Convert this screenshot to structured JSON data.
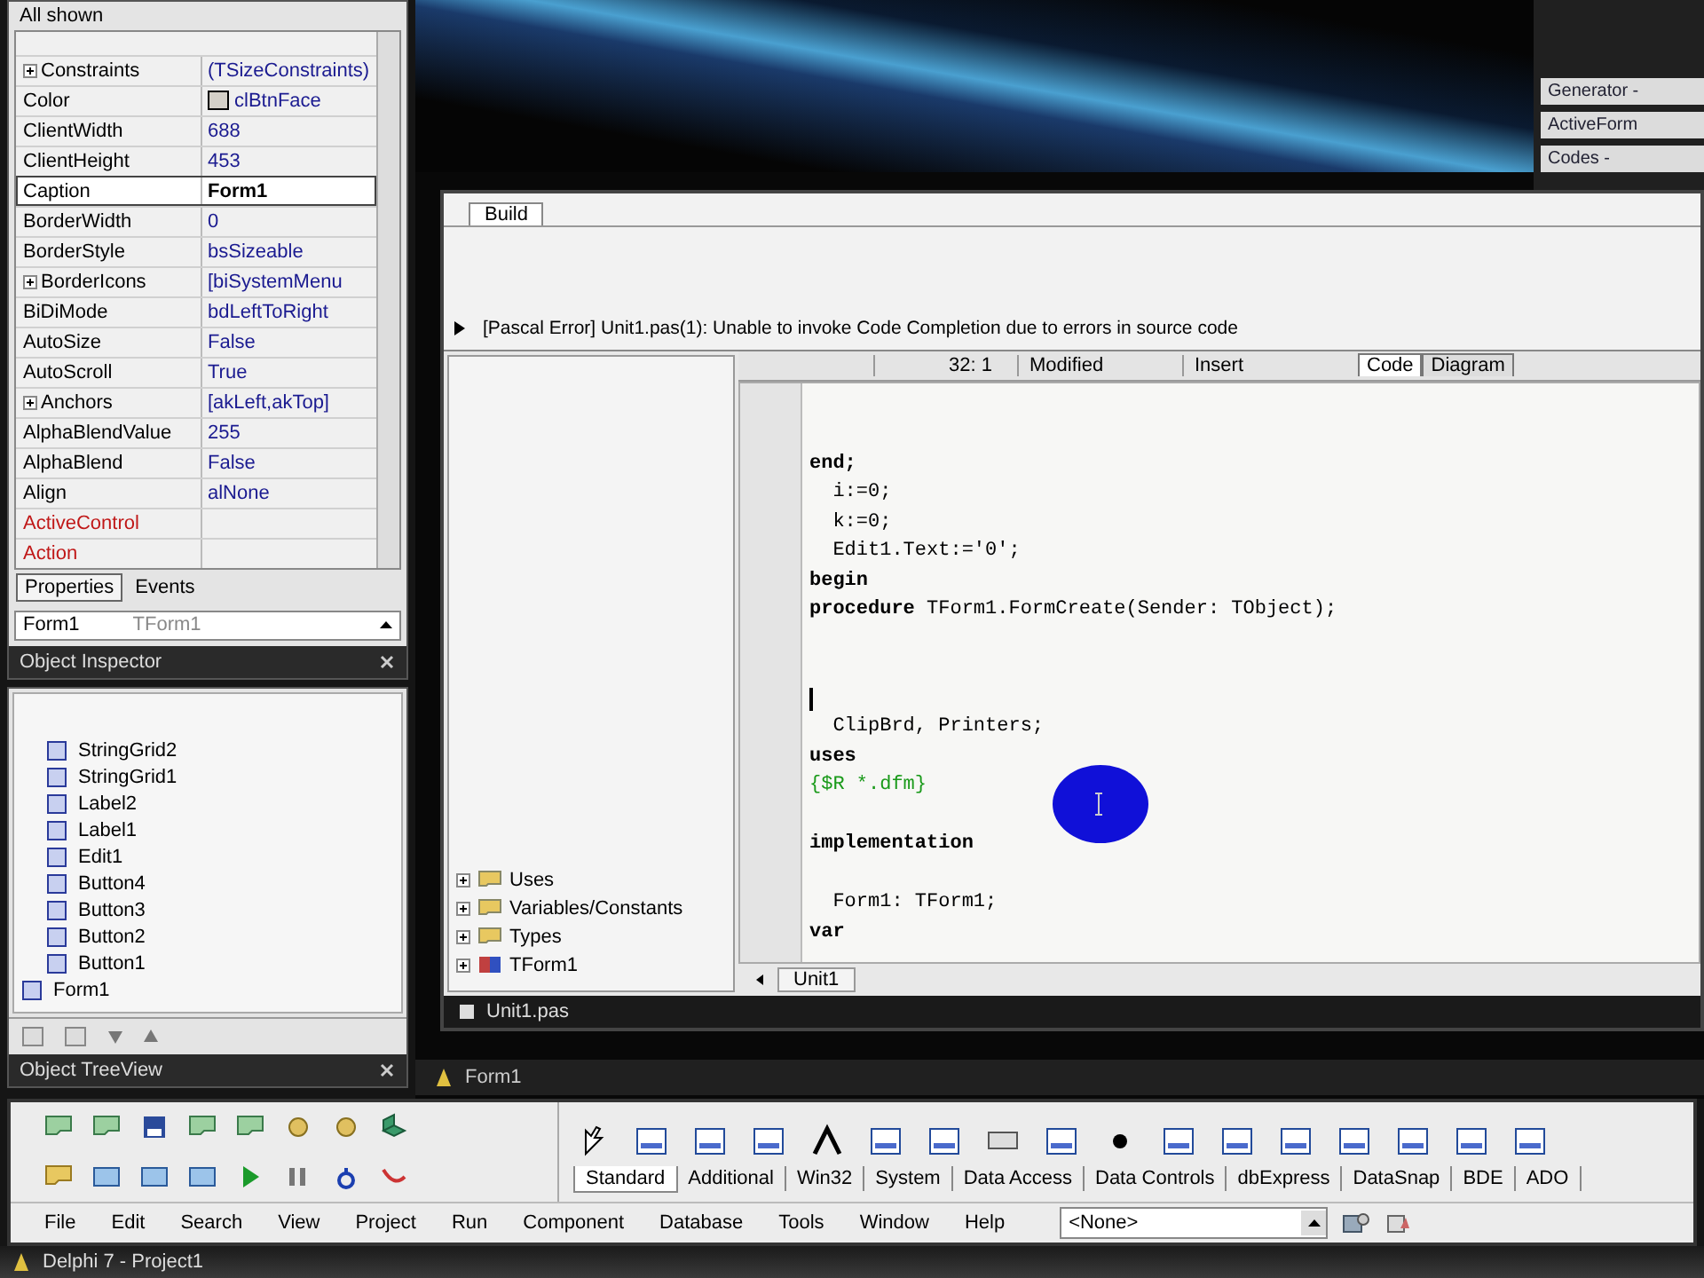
{
  "window": {
    "title": "Delphi 7 - Project1"
  },
  "menu": [
    "File",
    "Edit",
    "Search",
    "View",
    "Project",
    "Run",
    "Component",
    "Database",
    "Tools",
    "Window",
    "Help"
  ],
  "desktop_combo": {
    "value": "<None>"
  },
  "palette_tabs": [
    {
      "label": "Standard",
      "selected": true
    },
    {
      "label": "Additional",
      "selected": false
    },
    {
      "label": "Win32",
      "selected": false
    },
    {
      "label": "System",
      "selected": false
    },
    {
      "label": "Data Access",
      "selected": false
    },
    {
      "label": "Data Controls",
      "selected": false
    },
    {
      "label": "dbExpress",
      "selected": false
    },
    {
      "label": "DataSnap",
      "selected": false
    },
    {
      "label": "BDE",
      "selected": false
    },
    {
      "label": "ADO",
      "selected": false
    }
  ],
  "object_treeview": {
    "title": "Object TreeView",
    "items": [
      {
        "label": "Form1",
        "children": [
          {
            "label": "StringGrid2"
          },
          {
            "label": "StringGrid1"
          },
          {
            "label": "Label2"
          },
          {
            "label": "Label1"
          },
          {
            "label": "Edit1"
          },
          {
            "label": "Button4"
          },
          {
            "label": "Button3"
          },
          {
            "label": "Button2"
          },
          {
            "label": "Button1"
          }
        ]
      }
    ]
  },
  "object_inspector": {
    "title": "Object Inspector",
    "object": "Form1",
    "object_type": "TForm1",
    "tabs": [
      {
        "label": "Properties",
        "selected": true
      },
      {
        "label": "Events",
        "selected": false
      }
    ],
    "properties": [
      {
        "name": "Constraints",
        "value": "(TSizeConstraints)",
        "kind": "set",
        "selected": false
      },
      {
        "name": "Color",
        "value": "clBtnFace",
        "kind": "color",
        "selected": false
      },
      {
        "name": "ClientWidth",
        "value": "688",
        "kind": "plain",
        "selected": false
      },
      {
        "name": "ClientHeight",
        "value": "453",
        "kind": "plain",
        "selected": false
      },
      {
        "name": "Caption",
        "value": "Form1",
        "kind": "plain",
        "selected": true
      },
      {
        "name": "BorderWidth",
        "value": "0",
        "kind": "plain",
        "selected": false
      },
      {
        "name": "BorderStyle",
        "value": "bsSizeable",
        "kind": "plain",
        "selected": false
      },
      {
        "name": "BorderIcons",
        "value": "[biSystemMenu",
        "kind": "set",
        "selected": false
      },
      {
        "name": "BiDiMode",
        "value": "bdLeftToRight",
        "kind": "plain",
        "selected": false
      },
      {
        "name": "AutoSize",
        "value": "False",
        "kind": "plain",
        "selected": false
      },
      {
        "name": "AutoScroll",
        "value": "True",
        "kind": "plain",
        "selected": false
      },
      {
        "name": "Anchors",
        "value": "[akLeft,akTop]",
        "kind": "set",
        "selected": false
      },
      {
        "name": "AlphaBlendValue",
        "value": "255",
        "kind": "plain",
        "selected": false
      },
      {
        "name": "AlphaBlend",
        "value": "False",
        "kind": "plain",
        "selected": false
      },
      {
        "name": "Align",
        "value": "alNone",
        "kind": "plain",
        "selected": false
      },
      {
        "name": "ActiveControl",
        "kind": "reference",
        "selected": false
      },
      {
        "name": "Action",
        "kind": "reference",
        "selected": false
      }
    ],
    "status": "All shown"
  },
  "form_window": {
    "title": "Form1"
  },
  "editor": {
    "title": "Unit1.pas",
    "tabs": [
      {
        "label": "Unit1",
        "selected": true
      }
    ],
    "explorer": [
      {
        "label": "Uses",
        "kind": "folder"
      },
      {
        "label": "Variables/Constants",
        "kind": "folder"
      },
      {
        "label": "Types",
        "kind": "folder"
      },
      {
        "label": "TForm1",
        "kind": "class"
      }
    ],
    "lines": [
      {
        "text": "end;",
        "kind": "keyword"
      },
      {
        "text": "  i:=0;",
        "kind": "plain"
      },
      {
        "text": "  k:=0;",
        "kind": "plain"
      },
      {
        "text": "  Edit1.Text:='0';",
        "kind": "plain"
      },
      {
        "text": "begin",
        "kind": "keyword"
      },
      {
        "text": "**procedure** TForm1.FormCreate(Sender: TObject);",
        "kind": "rich"
      },
      {
        "kind": "blank"
      },
      {
        "kind": "blank"
      },
      {
        "kind": "cursor"
      },
      {
        "text": "  ClipBrd, Printers;",
        "kind": "plain"
      },
      {
        "text": "uses",
        "kind": "keyword"
      },
      {
        "text": "{$R *.dfm}",
        "kind": "comment"
      },
      {
        "kind": "blank"
      },
      {
        "text": "implementation",
        "kind": "keyword"
      },
      {
        "kind": "blank"
      },
      {
        "text": "  Form1: TForm1;",
        "kind": "plain"
      },
      {
        "text": "var",
        "kind": "keyword"
      }
    ],
    "status": {
      "position": "32: 1",
      "modified": "Modified",
      "mode": "Insert"
    },
    "view_tabs": [
      {
        "label": "Code",
        "selected": true
      },
      {
        "label": "Diagram",
        "selected": false
      }
    ],
    "messages": [
      "[Pascal Error] Unit1.pas(1): Unable to invoke Code Completion due to errors in source code"
    ],
    "message_tabs": [
      {
        "label": "Build",
        "selected": true
      }
    ]
  },
  "taskbar_windows": [
    {
      "label": "Generator -"
    },
    {
      "label": "ActiveForm"
    },
    {
      "label": "Codes -"
    }
  ]
}
